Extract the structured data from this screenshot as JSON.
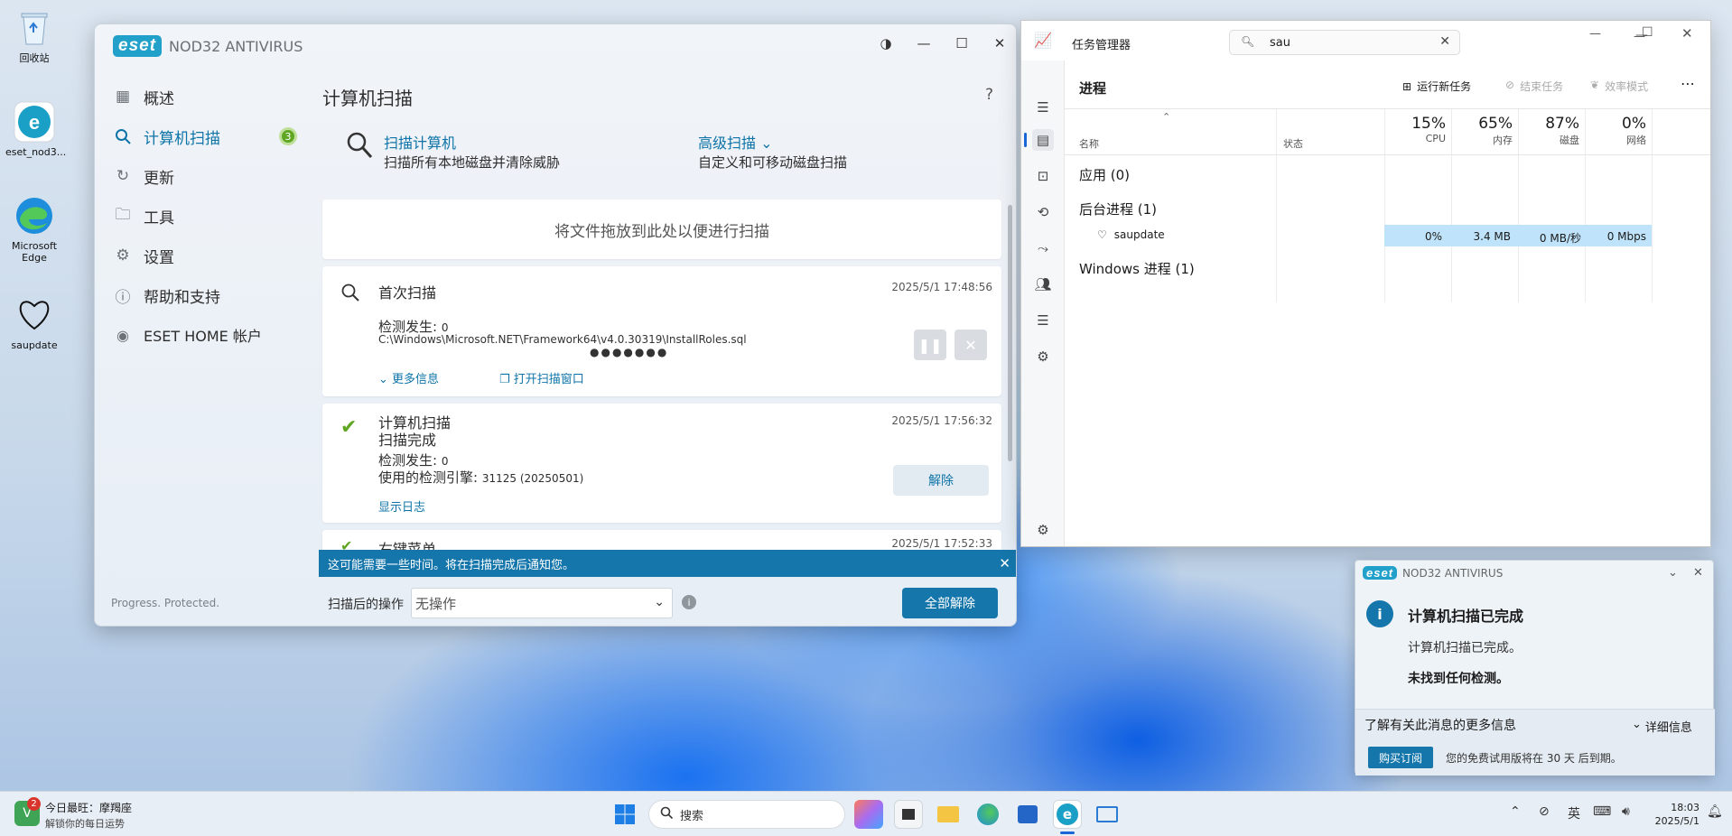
{
  "desktop": {
    "icons": [
      {
        "label": "回收站",
        "icon": "recycle-bin-icon"
      },
      {
        "label": "eset_nod3...",
        "icon": "eset-icon"
      },
      {
        "label": "Microsoft Edge",
        "icon": "edge-icon"
      },
      {
        "label": "saupdate",
        "icon": "heart-icon"
      }
    ]
  },
  "eset": {
    "logo": "eset",
    "product": "NOD32 ANTIVIRUS",
    "footer": "Progress. Protected.",
    "nav": [
      {
        "label": "概述",
        "icon": "dashboard-icon"
      },
      {
        "label": "计算机扫描",
        "icon": "search-icon",
        "badge": "3"
      },
      {
        "label": "更新",
        "icon": "refresh-icon"
      },
      {
        "label": "工具",
        "icon": "toolbox-icon"
      },
      {
        "label": "设置",
        "icon": "gear-icon"
      },
      {
        "label": "帮助和支持",
        "icon": "help-icon"
      },
      {
        "label": "ESET HOME 帐户",
        "icon": "account-icon"
      }
    ],
    "page_title": "计算机扫描",
    "help": "?",
    "scan_computer": {
      "title": "扫描计算机",
      "desc": "扫描所有本地磁盘并清除威胁"
    },
    "advanced_scan": {
      "title": "高级扫描",
      "desc": "自定义和可移动磁盘扫描"
    },
    "drop_zone": "将文件拖放到此处以便进行扫描",
    "scans": [
      {
        "name": "首次扫描",
        "time": "2025/5/1 17:48:56",
        "detect_label": "检测发生:",
        "detect_value": "0",
        "path": "C:\\Windows\\Microsoft.NET\\Framework64\\v4.0.30319\\InstallRoles.sql",
        "more_info": "更多信息",
        "open_window": "打开扫描窗口"
      },
      {
        "name": "计算机扫描",
        "status": "扫描完成",
        "time": "2025/5/1 17:56:32",
        "detect_label": "检测发生:",
        "detect_value": "0",
        "engine_label": "使用的检测引擎:",
        "engine_value": "31125 (20250501)",
        "dismiss": "解除",
        "show_log": "显示日志"
      },
      {
        "name": "右键菜单",
        "time": "2025/5/1 17:52:33"
      }
    ],
    "notice": "这可能需要一些时间。将在扫描完成后通知您。",
    "after_scan_label": "扫描后的操作",
    "after_scan_value": "无操作",
    "dismiss_all": "全部解除"
  },
  "taskmgr": {
    "title": "任务管理器",
    "search_value": "sau",
    "section": "进程",
    "run_new_task": "运行新任务",
    "end_task": "结束任务",
    "efficiency_mode": "效率模式",
    "columns": {
      "name": "名称",
      "status": "状态",
      "cpu_pct": "15%",
      "cpu": "CPU",
      "mem_pct": "65%",
      "mem": "内存",
      "disk_pct": "87%",
      "disk": "磁盘",
      "net_pct": "0%",
      "net": "网络"
    },
    "groups": {
      "apps": "应用 (0)",
      "background": "后台进程 (1)",
      "windows": "Windows 进程 (1)"
    },
    "process": {
      "name": "saupdate",
      "cpu": "0%",
      "mem": "3.4 MB",
      "disk": "0 MB/秒",
      "net": "0 Mbps"
    }
  },
  "toast": {
    "logo": "eset",
    "product": "NOD32 ANTIVIRUS",
    "title": "计算机扫描已完成",
    "line1": "计算机扫描已完成。",
    "line2": "未找到任何检测。",
    "more": "了解有关此消息的更多信息",
    "details": "详细信息",
    "buy": "购买订阅",
    "trial": "您的免费试用版将在 30 天 后到期。"
  },
  "taskbar": {
    "widget_badge": "2",
    "widget_title": "今日最旺：摩羯座",
    "widget_sub": "解锁你的每日运势",
    "search": "搜索",
    "ime": "英",
    "time": "18:03",
    "date": "2025/5/1"
  },
  "colors": {
    "accent": "#0e74a8",
    "eset_teal": "#21a0c9",
    "success": "#5fa622",
    "notice_bar": "#1576ab"
  }
}
